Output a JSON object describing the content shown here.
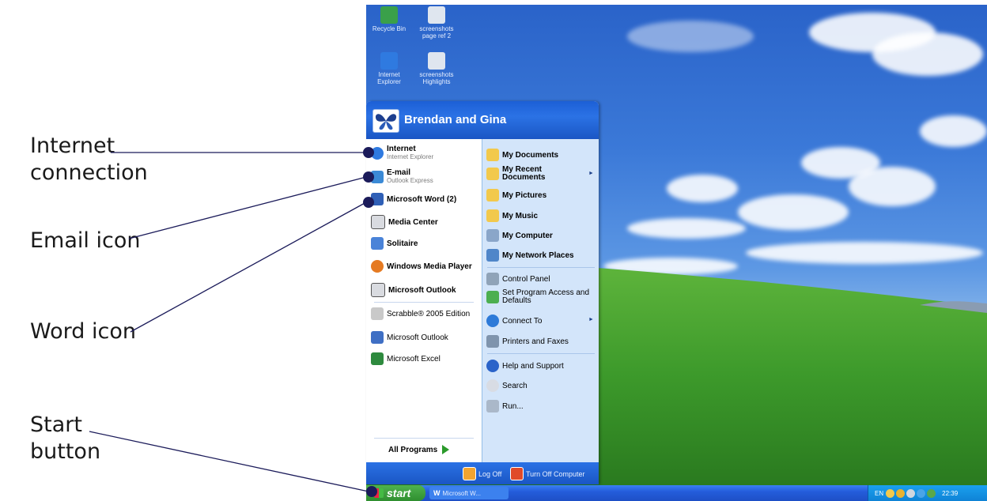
{
  "annotations": [
    {
      "lines": [
        "Internet",
        "connection"
      ]
    },
    {
      "lines": [
        "Email icon"
      ]
    },
    {
      "lines": [
        "Word icon"
      ]
    },
    {
      "lines": [
        "Start",
        "button"
      ]
    }
  ],
  "desktop": {
    "icons": [
      {
        "label": "Recycle Bin",
        "icon": "recycle-bin-icon",
        "color": "#3aa04a"
      },
      {
        "label": "screenshots page ref 2",
        "icon": "document-icon",
        "color": "#dfe6ef"
      },
      {
        "label": "Internet Explorer",
        "icon": "internet-explorer-icon",
        "color": "#2f7ae0"
      },
      {
        "label": "screenshots Highlights",
        "icon": "document-icon",
        "color": "#dfe6ef"
      }
    ]
  },
  "start_menu": {
    "user_name": "Brendan and Gina",
    "pinned": [
      {
        "title": "Internet",
        "subtitle": "Internet Explorer",
        "icon": "internet-explorer-icon",
        "color": "#2f7ae0"
      },
      {
        "title": "E-mail",
        "subtitle": "Outlook Express",
        "icon": "outlook-express-icon",
        "color": "#3b8ad6"
      }
    ],
    "recent": [
      {
        "label": "Microsoft Word (2)",
        "icon": "word-icon",
        "color": "#2f5fb6",
        "bold": true
      },
      {
        "label": "Media Center",
        "icon": "media-center-icon",
        "color": "#d9dbe0",
        "bold": true
      },
      {
        "label": "Solitaire",
        "icon": "solitaire-icon",
        "color": "#4a83d8",
        "bold": true
      },
      {
        "label": "Windows Media Player",
        "icon": "media-player-icon",
        "color": "#e57a22",
        "bold": true
      },
      {
        "label": "Microsoft Outlook",
        "icon": "outlook-icon",
        "color": "#d9dbe0",
        "bold": true
      },
      {
        "label": "Scrabble® 2005 Edition",
        "icon": "scrabble-icon",
        "color": "#c9c9c9",
        "bold": false
      },
      {
        "label": "Microsoft Outlook",
        "icon": "outlook-icon",
        "color": "#3f6fc4",
        "bold": false
      },
      {
        "label": "Microsoft Excel",
        "icon": "excel-icon",
        "color": "#2e8a3e",
        "bold": false
      }
    ],
    "all_programs_label": "All Programs",
    "right_items": [
      {
        "label": "My Documents",
        "icon": "folder-icon",
        "color": "#f2c94c",
        "bold": true,
        "submenu": false
      },
      {
        "label": "My Recent Documents",
        "icon": "recent-documents-icon",
        "color": "#f2c94c",
        "bold": true,
        "submenu": true
      },
      {
        "label": "My Pictures",
        "icon": "folder-icon",
        "color": "#f2c94c",
        "bold": true,
        "submenu": false
      },
      {
        "label": "My Music",
        "icon": "folder-icon",
        "color": "#f2c94c",
        "bold": true,
        "submenu": false
      },
      {
        "label": "My Computer",
        "icon": "computer-icon",
        "color": "#8aa6c9",
        "bold": true,
        "submenu": false
      },
      {
        "label": "My Network Places",
        "icon": "network-icon",
        "color": "#4f86c9",
        "bold": true,
        "submenu": false
      },
      {
        "label": "Control Panel",
        "icon": "control-panel-icon",
        "color": "#8fa3b8",
        "bold": false,
        "submenu": false
      },
      {
        "label": "Set Program Access and Defaults",
        "icon": "program-access-icon",
        "color": "#4caf50",
        "bold": false,
        "submenu": false
      },
      {
        "label": "Connect To",
        "icon": "connect-icon",
        "color": "#2d7ad8",
        "bold": false,
        "submenu": true
      },
      {
        "label": "Printers and Faxes",
        "icon": "printer-icon",
        "color": "#7f94ad",
        "bold": false,
        "submenu": false
      },
      {
        "label": "Help and Support",
        "icon": "help-icon",
        "color": "#2a63c9",
        "bold": false,
        "submenu": false
      },
      {
        "label": "Search",
        "icon": "search-icon",
        "color": "#d8dce4",
        "bold": false,
        "submenu": false
      },
      {
        "label": "Run...",
        "icon": "run-icon",
        "color": "#aab8c9",
        "bold": false,
        "submenu": false
      }
    ],
    "log_off_label": "Log Off",
    "turn_off_label": "Turn Off Computer"
  },
  "taskbar": {
    "start_label": "start",
    "task_label": "Microsoft W...",
    "tray_lang": "EN",
    "clock": "22:39"
  },
  "colors": {
    "xp_blue": "#245ddb",
    "start_green": "#3a9a3a",
    "menu_right_bg": "#d3e5fa"
  }
}
